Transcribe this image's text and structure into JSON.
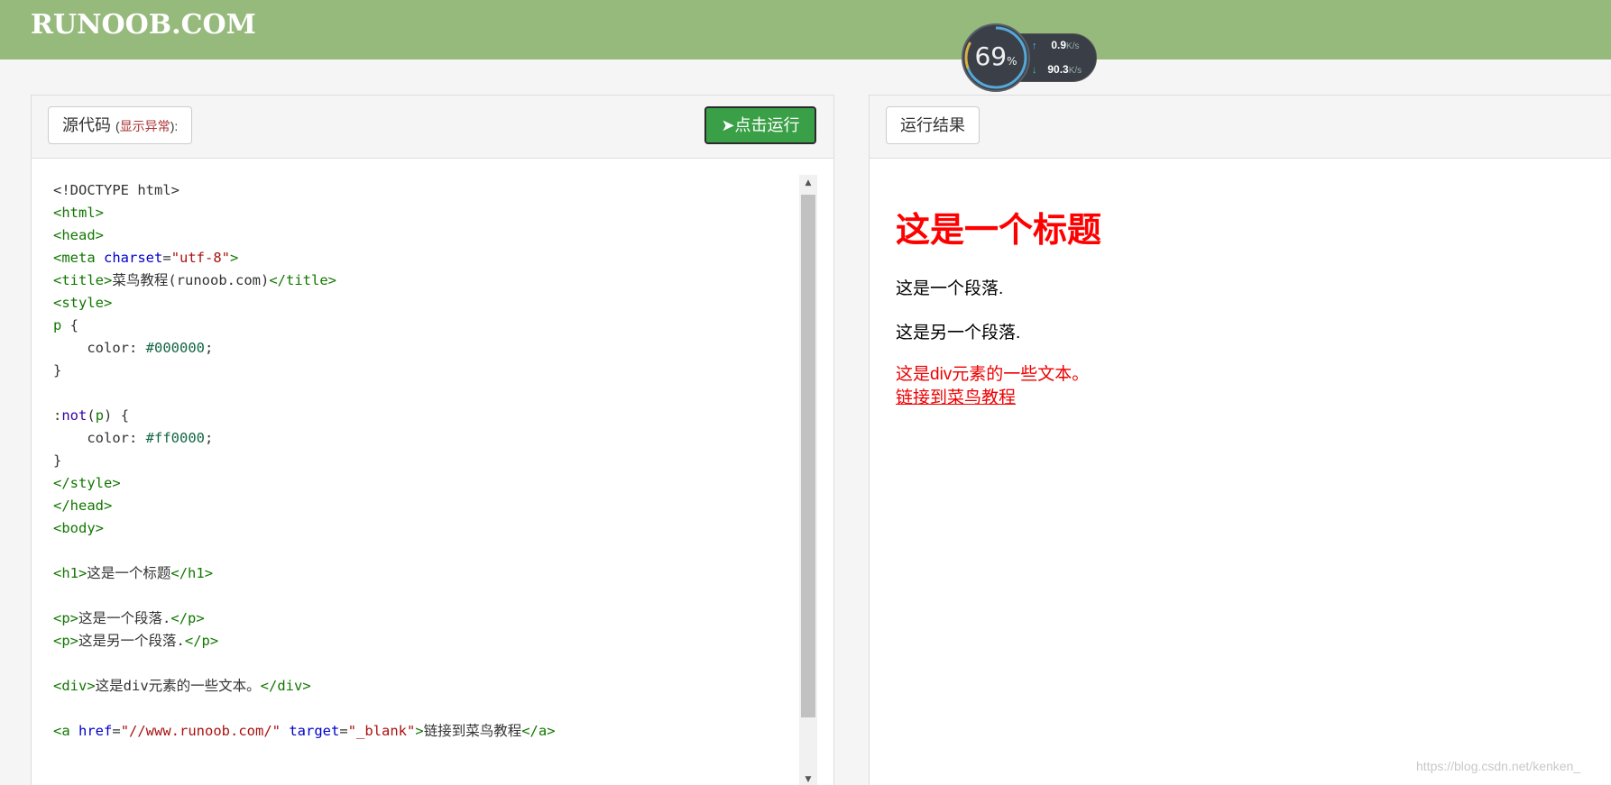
{
  "header": {
    "logo": "RUNOOB.COM",
    "bg_color": "#96b97c"
  },
  "net_widget": {
    "percent": "69",
    "percent_unit": "%",
    "upload": "0.9",
    "upload_unit": "K/s",
    "download": "90.3",
    "download_unit": "K/s"
  },
  "editor": {
    "tab_label": "源代码",
    "tab_sub_open": "(",
    "tab_sub_link": "显示异常",
    "tab_sub_close": "):",
    "run_button": "点击运行",
    "run_button_color": "#3aa047"
  },
  "code_lines": [
    "<!DOCTYPE html>",
    "<html>",
    "<head>",
    "<meta charset=\"utf-8\">",
    "<title>菜鸟教程(runoob.com)</title>",
    "<style>",
    "p {",
    "    color: #000000;",
    "}",
    "",
    ":not(p) {",
    "    color: #ff0000;",
    "}",
    "</style>",
    "</head>",
    "<body>",
    "",
    "<h1>这是一个标题</h1>",
    "",
    "<p>这是一个段落.</p>",
    "<p>这是另一个段落.</p>",
    "",
    "<div>这是div元素的一些文本。</div>",
    "",
    "<a href=\"//www.runoob.com/\" target=\"_blank\">链接到菜鸟教程</a>"
  ],
  "result": {
    "tab_label": "运行结果",
    "heading": "这是一个标题",
    "para1": "这是一个段落.",
    "para2": "这是另一个段落.",
    "div_text": "这是div元素的一些文本。",
    "link_text": "链接到菜鸟教程"
  },
  "watermark": "https://blog.csdn.net/kenken_"
}
